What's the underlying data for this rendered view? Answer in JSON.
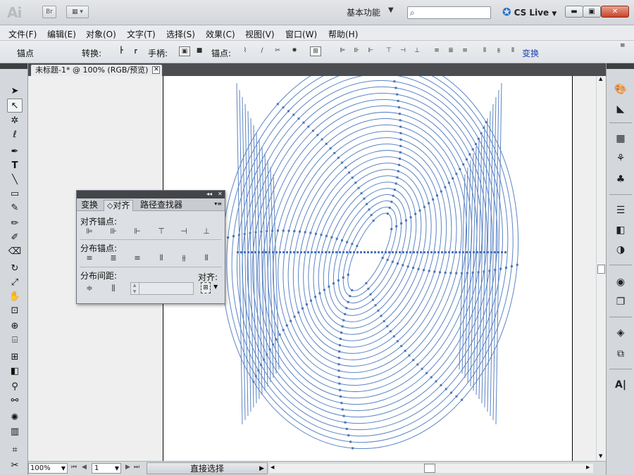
{
  "titlebar": {
    "app_logo": "Ai",
    "bridge_button": "Br",
    "arrange_button_icon": "arrange-documents-icon",
    "workspace": "基本功能",
    "search_placeholder": "",
    "cslive": "CS Live",
    "window_buttons": [
      "minimize",
      "maximize",
      "close"
    ]
  },
  "menubar": {
    "items": [
      "文件(F)",
      "编辑(E)",
      "对象(O)",
      "文字(T)",
      "选择(S)",
      "效果(C)",
      "视图(V)",
      "窗口(W)",
      "帮助(H)"
    ]
  },
  "controlbar": {
    "anchor_label": "锚点",
    "convert_label": "转换:",
    "handles_label": "手柄:",
    "anchors_label": "锚点:",
    "transform_link": "变换"
  },
  "document": {
    "tab_title": "未标题-1* @ 100% (RGB/预览)",
    "zoom": "100%",
    "page": "1",
    "status": "直接选择"
  },
  "align_panel": {
    "tabs": [
      "变换",
      "对齐",
      "路径查找器"
    ],
    "active_tab": "对齐",
    "sections": {
      "align_anchors": "对齐锚点:",
      "distribute_anchors": "分布锚点:",
      "distribute_spacing": "分布间距:",
      "align_to": "对齐:"
    }
  },
  "colors": {
    "path_stroke": "#5b84c4",
    "anchor_fill": "#4a74b8",
    "artboard": "#ffffff",
    "pasteboard": "#efefef"
  }
}
